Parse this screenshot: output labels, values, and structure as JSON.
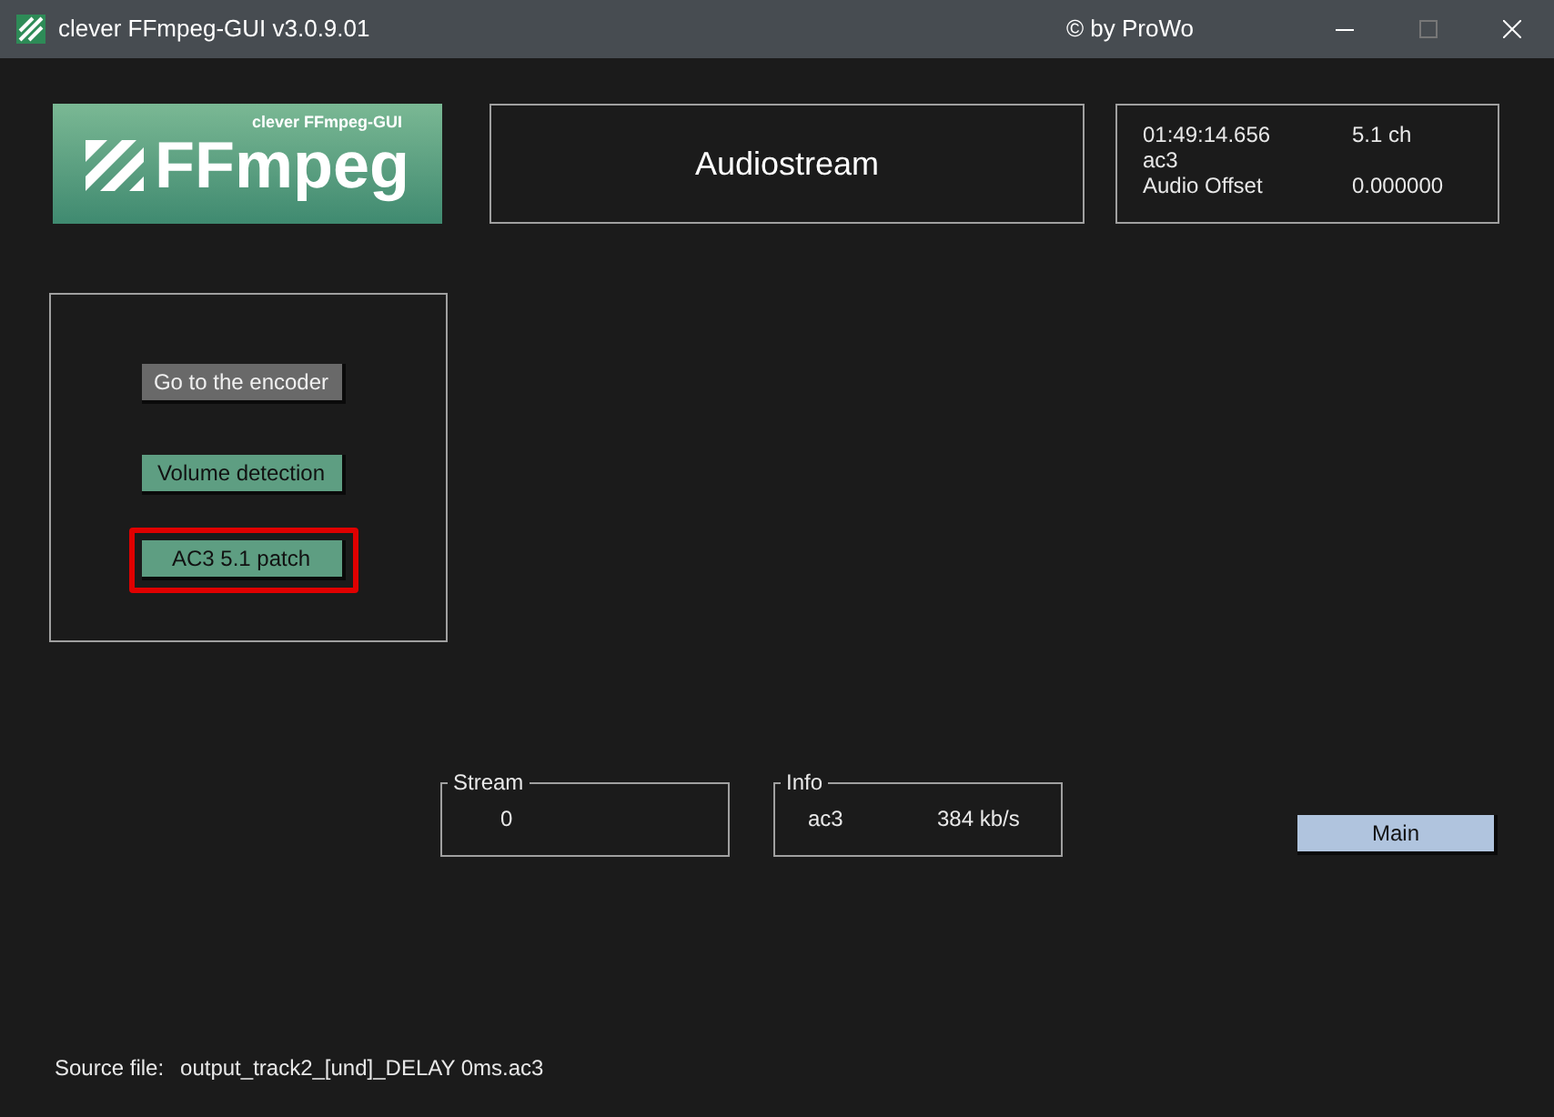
{
  "window": {
    "title": "clever FFmpeg-GUI v3.0.9.01",
    "credit": "© by ProWo"
  },
  "logo": {
    "caption": "clever FFmpeg-GUI",
    "wordmark": "FFmpeg"
  },
  "heading": "Audiostream",
  "info": {
    "duration": "01:49:14.656",
    "channels": "5.1 ch",
    "codec": "ac3",
    "offset_label": "Audio Offset",
    "offset_value": "0.000000"
  },
  "buttons": [
    {
      "label": "Go to the encoder",
      "kind": "gray",
      "highlighted": false
    },
    {
      "label": "Volume detection",
      "kind": "green",
      "highlighted": false
    },
    {
      "label": "AC3 5.1 patch",
      "kind": "green",
      "highlighted": true
    }
  ],
  "stream_group": {
    "legend": "Stream",
    "value": "0"
  },
  "info_group": {
    "legend": "Info",
    "codec": "ac3",
    "bitrate": "384 kb/s"
  },
  "main_button": {
    "label": "Main"
  },
  "source": {
    "label": "Source file:",
    "value": "output_track2_[und]_DELAY 0ms.ac3"
  }
}
